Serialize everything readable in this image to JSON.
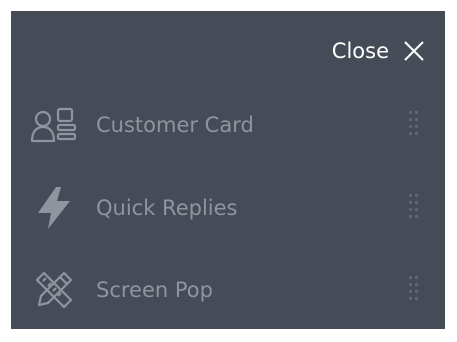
{
  "panel": {
    "close_label": "Close"
  },
  "menu": {
    "items": [
      {
        "label": "Customer Card",
        "icon": "customer-card-icon"
      },
      {
        "label": "Quick Replies",
        "icon": "lightning-bolt-icon"
      },
      {
        "label": "Screen Pop",
        "icon": "pencil-ruler-icon"
      }
    ]
  },
  "colors": {
    "panel_background": "#454c57",
    "close_text": "#ffffff",
    "item_text": "#8f959e",
    "icon": "#8f959e",
    "drag_handle": "#5f6670"
  }
}
